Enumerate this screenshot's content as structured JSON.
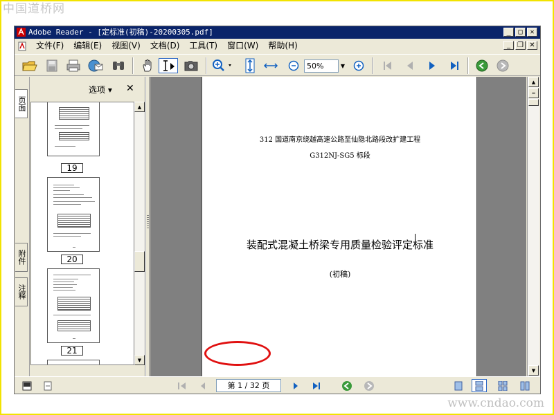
{
  "watermark": {
    "top_left": "中国道桥网",
    "bottom_right": "www.cndao.com"
  },
  "window": {
    "title": "Adobe Reader - [定标准(初稿)-20200305.pdf]",
    "buttons": [
      "minimize",
      "maximize",
      "close"
    ]
  },
  "menubar": {
    "items": [
      "文件(F)",
      "编辑(E)",
      "视图(V)",
      "文档(D)",
      "工具(T)",
      "窗口(W)",
      "帮助(H)"
    ]
  },
  "toolbar": {
    "zoom_value": "50%",
    "icons": [
      "open-folder-icon",
      "save-icon",
      "print-icon",
      "email-icon",
      "search-binoculars-icon",
      "hand-tool-icon",
      "select-text-icon",
      "snapshot-icon",
      "zoom-in-icon",
      "fit-page-icon",
      "fit-width-icon",
      "zoom-out-minus-icon",
      "zoom-plus-icon",
      "first-page-icon",
      "previous-page-icon",
      "next-page-icon",
      "last-page-icon",
      "back-icon",
      "forward-icon"
    ]
  },
  "nav_rail": {
    "tabs": [
      "页面",
      "附件",
      "注释"
    ]
  },
  "pages_panel": {
    "options_label": "选项 ▾",
    "close_label": "✕",
    "thumbnails": [
      "19",
      "20",
      "21"
    ]
  },
  "document": {
    "line1": "312 国道南京绕越高速公路至仙隐北路段改扩建工程",
    "line2": "G312NJ-SG5 标段",
    "title": "装配式混凝土桥梁专用质量检验评定标准",
    "subtitle": "(初稿)"
  },
  "statusbar": {
    "page_indicator": "第 1 / 32 页"
  }
}
